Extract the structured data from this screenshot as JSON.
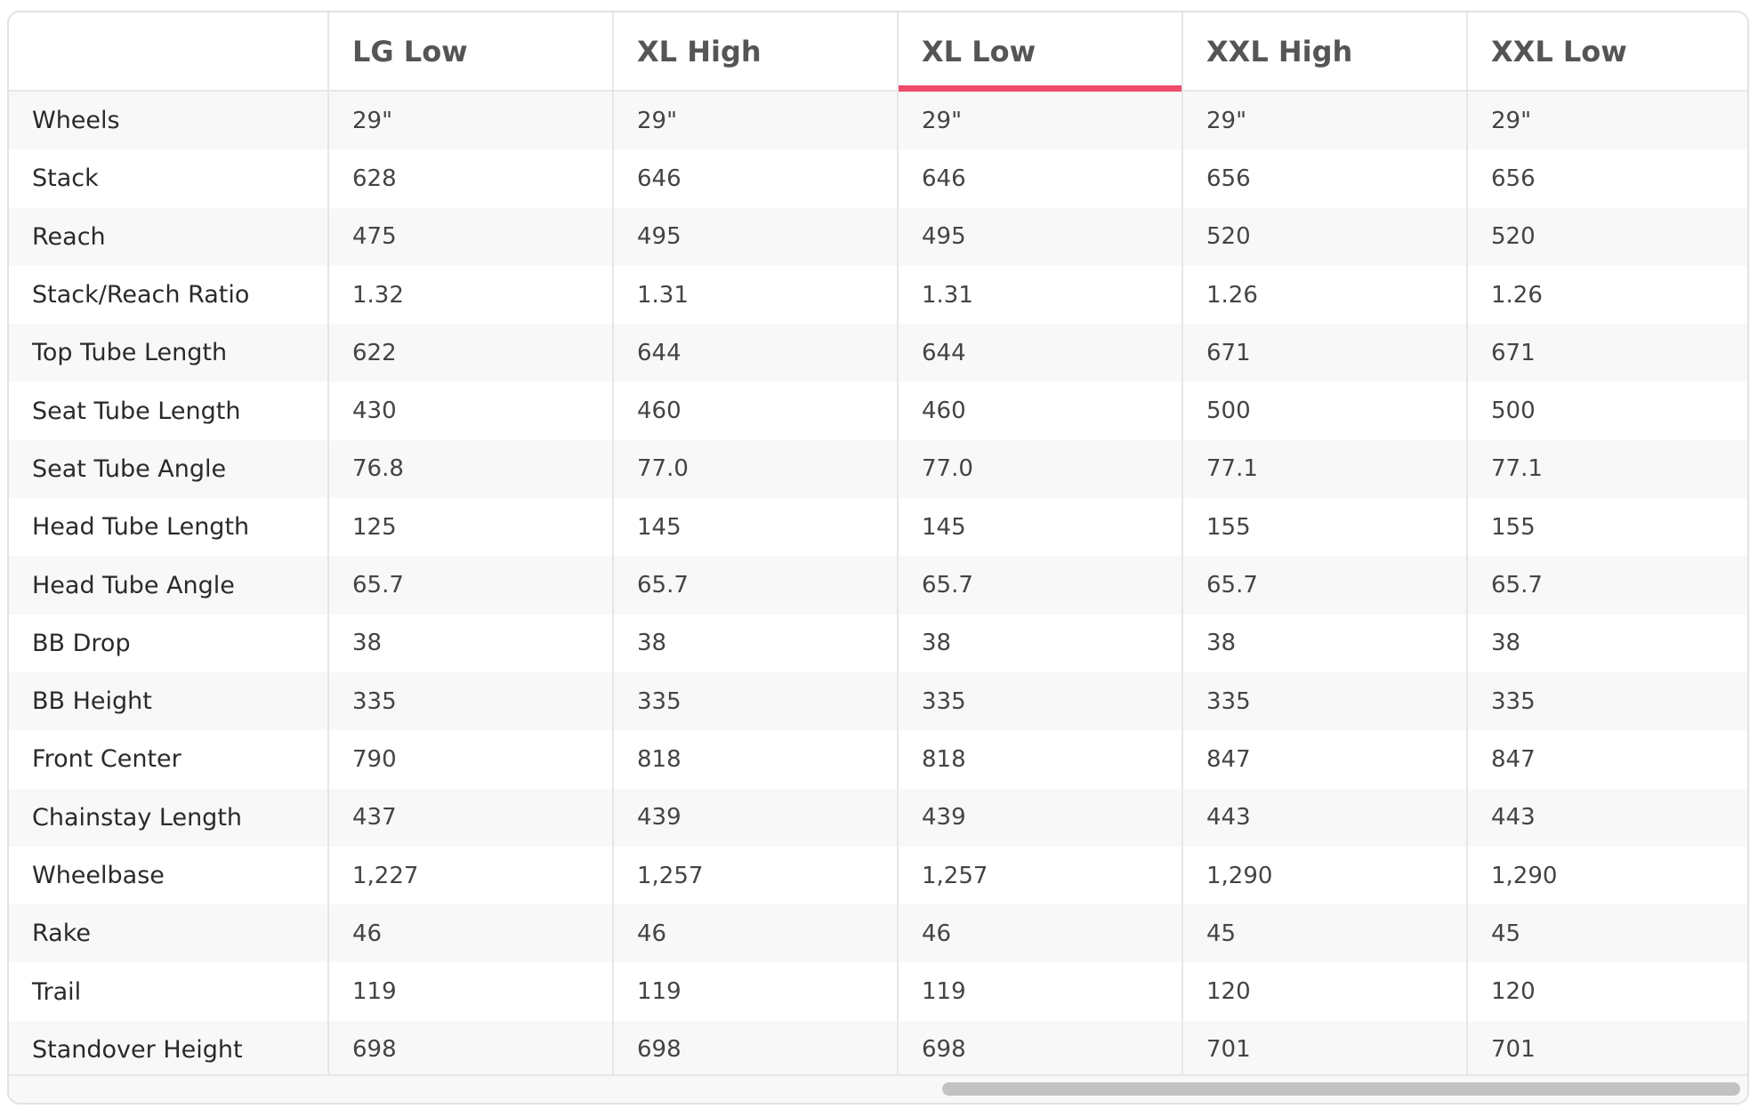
{
  "geometry_table": {
    "columns": [
      "",
      "LG Low",
      "XL High",
      "XL Low",
      "XXL High",
      "XXL Low"
    ],
    "active_column": "XL Low",
    "active_color": "#ee4a6a",
    "rows": [
      {
        "label": "Wheels",
        "values": [
          "29\"",
          "29\"",
          "29\"",
          "29\"",
          "29\""
        ]
      },
      {
        "label": "Stack",
        "values": [
          "628",
          "646",
          "646",
          "656",
          "656"
        ]
      },
      {
        "label": "Reach",
        "values": [
          "475",
          "495",
          "495",
          "520",
          "520"
        ]
      },
      {
        "label": "Stack/Reach Ratio",
        "values": [
          "1.32",
          "1.31",
          "1.31",
          "1.26",
          "1.26"
        ]
      },
      {
        "label": "Top Tube Length",
        "values": [
          "622",
          "644",
          "644",
          "671",
          "671"
        ]
      },
      {
        "label": "Seat Tube Length",
        "values": [
          "430",
          "460",
          "460",
          "500",
          "500"
        ]
      },
      {
        "label": "Seat Tube Angle",
        "values": [
          "76.8",
          "77.0",
          "77.0",
          "77.1",
          "77.1"
        ]
      },
      {
        "label": "Head Tube Length",
        "values": [
          "125",
          "145",
          "145",
          "155",
          "155"
        ]
      },
      {
        "label": "Head Tube Angle",
        "values": [
          "65.7",
          "65.7",
          "65.7",
          "65.7",
          "65.7"
        ]
      },
      {
        "label": "BB Drop",
        "values": [
          "38",
          "38",
          "38",
          "38",
          "38"
        ]
      },
      {
        "label": "BB Height",
        "values": [
          "335",
          "335",
          "335",
          "335",
          "335"
        ]
      },
      {
        "label": "Front Center",
        "values": [
          "790",
          "818",
          "818",
          "847",
          "847"
        ]
      },
      {
        "label": "Chainstay Length",
        "values": [
          "437",
          "439",
          "439",
          "443",
          "443"
        ]
      },
      {
        "label": "Wheelbase",
        "values": [
          "1,227",
          "1,257",
          "1,257",
          "1,290",
          "1,290"
        ]
      },
      {
        "label": "Rake",
        "values": [
          "46",
          "46",
          "46",
          "45",
          "45"
        ]
      },
      {
        "label": "Trail",
        "values": [
          "119",
          "119",
          "119",
          "120",
          "120"
        ]
      },
      {
        "label": "Standover Height",
        "values": [
          "698",
          "698",
          "698",
          "701",
          "701"
        ]
      }
    ]
  }
}
